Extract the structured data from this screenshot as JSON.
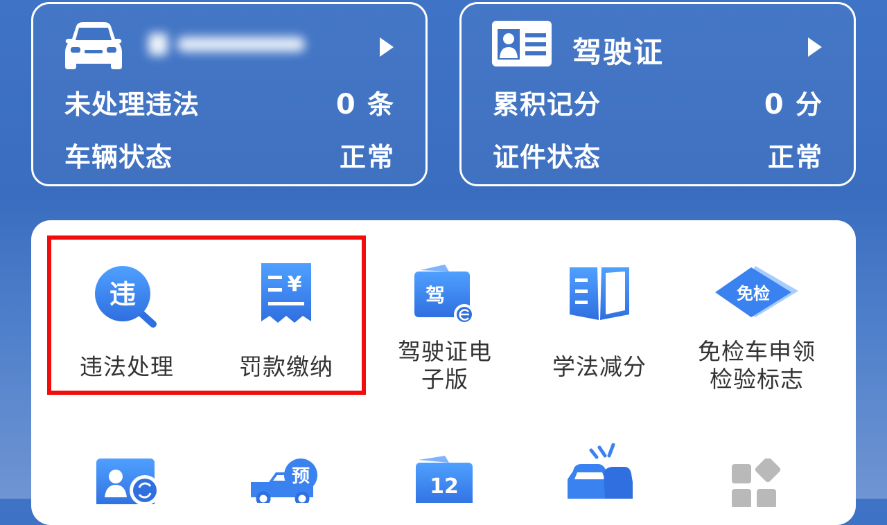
{
  "vehicle_card": {
    "plate_masked": "",
    "unprocessed_label": "未处理违法",
    "unprocessed_count": "0",
    "unprocessed_unit": "条",
    "status_label": "车辆状态",
    "status_value": "正常",
    "icon": "car-icon"
  },
  "license_card": {
    "title": "驾驶证",
    "points_label": "累积记分",
    "points_count": "0",
    "points_unit": "分",
    "status_label": "证件状态",
    "status_value": "正常",
    "icon": "id-card-icon"
  },
  "services": [
    {
      "label": "违法处理",
      "icon": "violation-search-icon"
    },
    {
      "label": "罚款缴纳",
      "icon": "fine-receipt-icon"
    },
    {
      "label_line1": "驾驶证电",
      "label_line2": "子版",
      "icon": "e-license-icon"
    },
    {
      "label": "学法减分",
      "icon": "study-book-icon"
    },
    {
      "label_line1": "免检车申领",
      "label_line2": "检验标志",
      "icon": "exemption-icon"
    }
  ],
  "service_icon_text": {
    "violation": "违",
    "fine": "¥",
    "e_license": "驾",
    "exemption": "免检",
    "twelve": "12",
    "reserve": "预"
  },
  "colors": {
    "accent": "#2f73e6",
    "highlight": "#f20c0c",
    "header_bg": "#3f73c6"
  }
}
